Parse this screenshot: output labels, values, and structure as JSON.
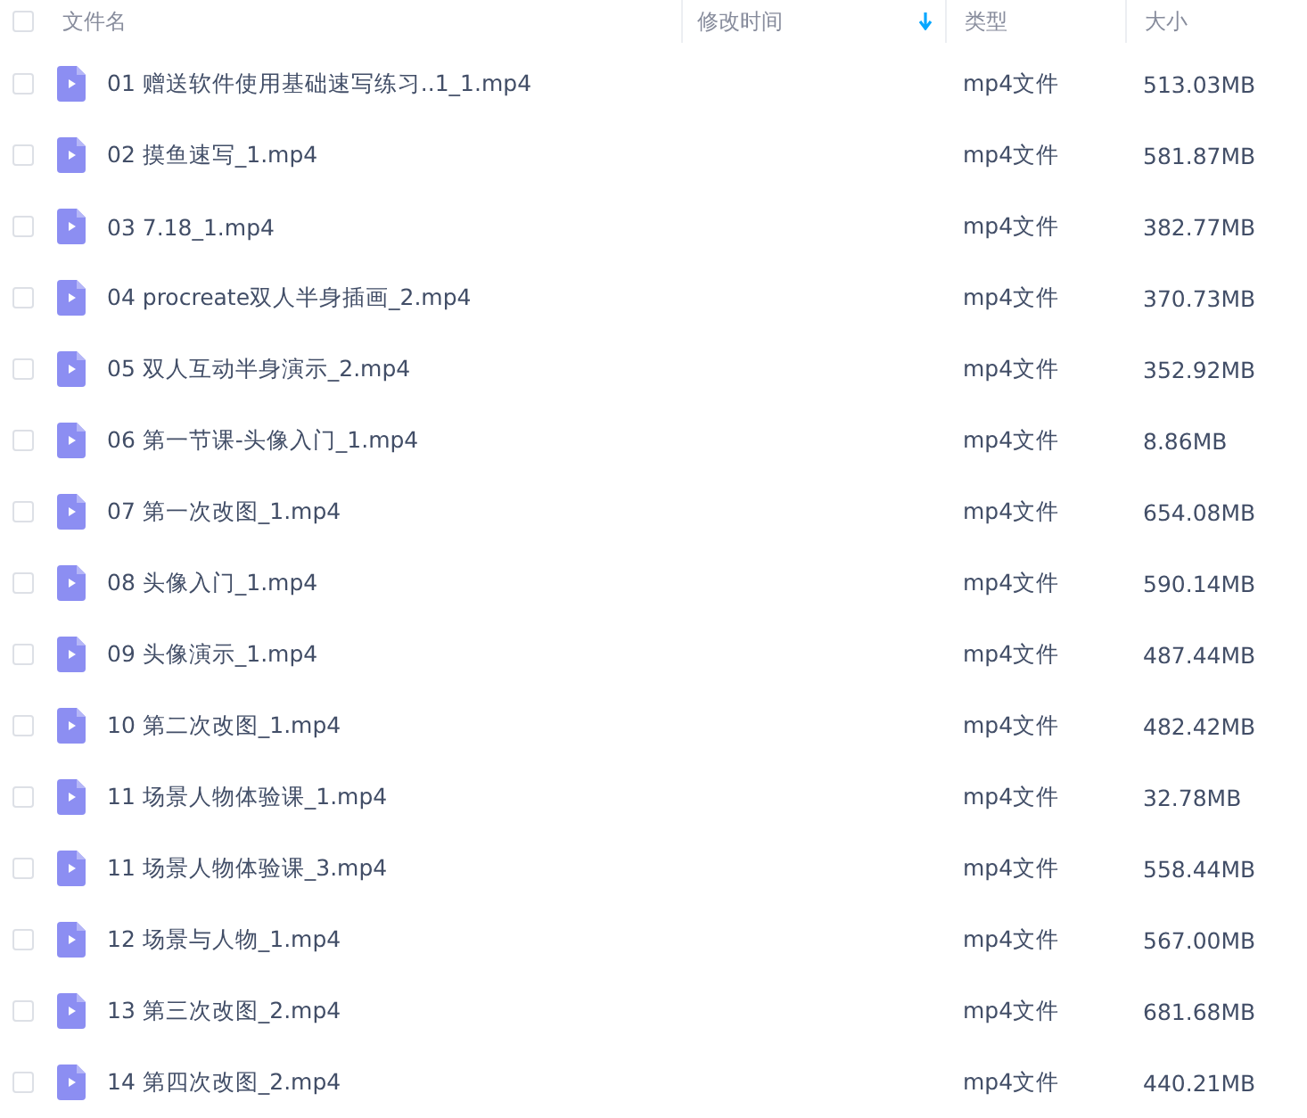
{
  "header": {
    "checked": false,
    "columns": [
      {
        "label": "文件名"
      },
      {
        "label": "修改时间",
        "sorted": true
      },
      {
        "label": "类型"
      },
      {
        "label": "大小"
      }
    ]
  },
  "rows": [
    {
      "checked": false,
      "name": "01 赠送软件使用基础速写练习..1_1.mp4",
      "type": "mp4文件",
      "size": "513.03MB"
    },
    {
      "checked": false,
      "name": "02 摸鱼速写_1.mp4",
      "type": "mp4文件",
      "size": "581.87MB"
    },
    {
      "checked": false,
      "name": "03 7.18_1.mp4",
      "type": "mp4文件",
      "size": "382.77MB"
    },
    {
      "checked": false,
      "name": "04 procreate双人半身插画_2.mp4",
      "type": "mp4文件",
      "size": "370.73MB"
    },
    {
      "checked": false,
      "name": "05 双人互动半身演示_2.mp4",
      "type": "mp4文件",
      "size": "352.92MB"
    },
    {
      "checked": false,
      "name": "06 第一节课-头像入门_1.mp4",
      "type": "mp4文件",
      "size": "8.86MB"
    },
    {
      "checked": false,
      "name": "07 第一次改图_1.mp4",
      "type": "mp4文件",
      "size": "654.08MB"
    },
    {
      "checked": false,
      "name": "08 头像入门_1.mp4",
      "type": "mp4文件",
      "size": "590.14MB"
    },
    {
      "checked": false,
      "name": "09 头像演示_1.mp4",
      "type": "mp4文件",
      "size": "487.44MB"
    },
    {
      "checked": false,
      "name": "10 第二次改图_1.mp4",
      "type": "mp4文件",
      "size": "482.42MB"
    },
    {
      "checked": false,
      "name": "11 场景人物体验课_1.mp4",
      "type": "mp4文件",
      "size": "32.78MB"
    },
    {
      "checked": false,
      "name": "11 场景人物体验课_3.mp4",
      "type": "mp4文件",
      "size": "558.44MB"
    },
    {
      "checked": false,
      "name": "12 场景与人物_1.mp4",
      "type": "mp4文件",
      "size": "567.00MB"
    },
    {
      "checked": false,
      "name": "13 第三次改图_2.mp4",
      "type": "mp4文件",
      "size": "681.68MB"
    },
    {
      "checked": false,
      "name": "14 第四次改图_2.mp4",
      "type": "mp4文件",
      "size": "440.21MB"
    }
  ]
}
